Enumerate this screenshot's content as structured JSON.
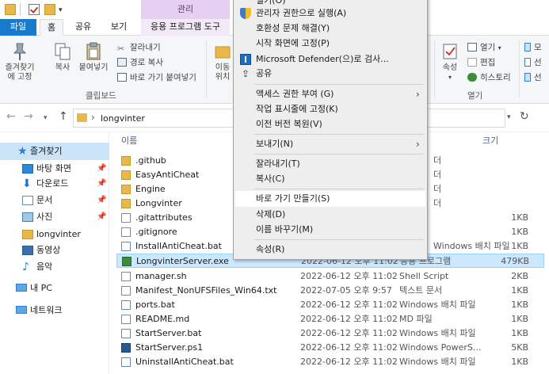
{
  "titlebar": {
    "manage_tab": "관리"
  },
  "tabs": {
    "file": "파일",
    "home": "홈",
    "share": "공유",
    "view": "보기",
    "app_tools": "응용 프로그램 도구"
  },
  "ribbon": {
    "pin_quick": "즐겨찾기에 고정",
    "copy": "복사",
    "paste": "붙여넣기",
    "cut": "잘라내기",
    "copy_path": "경로 복사",
    "paste_shortcut": "바로 가기 붙여넣기",
    "clipboard_group": "클립보드",
    "move_to": "이동 위치",
    "properties": "속성",
    "open": "열기",
    "edit": "편집",
    "history": "히스토리",
    "open_group": "열기",
    "select_all": "모",
    "select_none": "선",
    "invert_selection": "선"
  },
  "address": {
    "path": "longvinter"
  },
  "navpane": {
    "items": [
      {
        "label": "즐겨찾기",
        "pinned": false
      },
      {
        "label": "바탕 화면",
        "pinned": true
      },
      {
        "label": "다운로드",
        "pinned": true
      },
      {
        "label": "문서",
        "pinned": true
      },
      {
        "label": "사진",
        "pinned": true
      },
      {
        "label": "longvinter",
        "pinned": false
      },
      {
        "label": "동영상",
        "pinned": false
      },
      {
        "label": "음악",
        "pinned": false
      },
      {
        "label": "내 PC",
        "pinned": false
      },
      {
        "label": "네트워크",
        "pinned": false
      }
    ]
  },
  "filelist": {
    "headers": {
      "name": "이름",
      "size": "크기"
    },
    "rows": [
      {
        "name": ".github",
        "date": "",
        "type": "더",
        "size": "",
        "icon": "folder"
      },
      {
        "name": "EasyAntiCheat",
        "date": "",
        "type": "더",
        "size": "",
        "icon": "folder"
      },
      {
        "name": "Engine",
        "date": "",
        "type": "더",
        "size": "",
        "icon": "folder"
      },
      {
        "name": "Longvinter",
        "date": "",
        "type": "더",
        "size": "",
        "icon": "folder"
      },
      {
        "name": ".gitattributes",
        "date": "",
        "type": "",
        "size": "1KB",
        "icon": "file"
      },
      {
        "name": ".gitignore",
        "date": "",
        "type": "",
        "size": "1KB",
        "icon": "file"
      },
      {
        "name": "InstallAntiCheat.bat",
        "date": "",
        "type": "Windows 배치 파일",
        "size": "1KB",
        "icon": "bat"
      },
      {
        "name": "LongvinterServer.exe",
        "date": "2022-06-12 오후 11:02",
        "type": "응용 프로그램",
        "size": "479KB",
        "icon": "exe"
      },
      {
        "name": "manager.sh",
        "date": "2022-06-12 오후 11:02",
        "type": "Shell Script",
        "size": "2KB",
        "icon": "file"
      },
      {
        "name": "Manifest_NonUFSFiles_Win64.txt",
        "date": "2022-07-05 오후 9:57",
        "type": "텍스트 문서",
        "size": "1KB",
        "icon": "file"
      },
      {
        "name": "ports.bat",
        "date": "2022-06-12 오후 11:02",
        "type": "Windows 배치 파일",
        "size": "1KB",
        "icon": "bat"
      },
      {
        "name": "README.md",
        "date": "2022-06-12 오후 11:02",
        "type": "MD 파일",
        "size": "1KB",
        "icon": "file"
      },
      {
        "name": "StartServer.bat",
        "date": "2022-06-12 오후 11:02",
        "type": "Windows 배치 파일",
        "size": "1KB",
        "icon": "bat"
      },
      {
        "name": "StartServer.ps1",
        "date": "2022-06-12 오후 11:02",
        "type": "Windows PowerS...",
        "size": "5KB",
        "icon": "ps1"
      },
      {
        "name": "UninstallAntiCheat.bat",
        "date": "2022-06-12 오후 11:02",
        "type": "Windows 배치 파일",
        "size": "1KB",
        "icon": "bat"
      }
    ]
  },
  "context_menu": {
    "top_fragment": "열기(O)",
    "run_as_admin": "관리자 권한으로 실행(A)",
    "troubleshoot": "호환성 문제 해결(Y)",
    "pin_start": "시작 화면에 고정(P)",
    "defender": "Microsoft Defender(으)로 검사...",
    "share": "공유",
    "give_access": "액세스 권한 부여 (G)",
    "pin_taskbar": "작업 표시줄에 고정(K)",
    "restore_versions": "이전 버전 복원(V)",
    "send_to": "보내기(N)",
    "cut": "잘라내기(T)",
    "copy": "복사(C)",
    "create_shortcut": "바로 가기 만들기(S)",
    "delete": "삭제(D)",
    "rename": "이름 바꾸기(M)",
    "properties": "속성(R)"
  }
}
